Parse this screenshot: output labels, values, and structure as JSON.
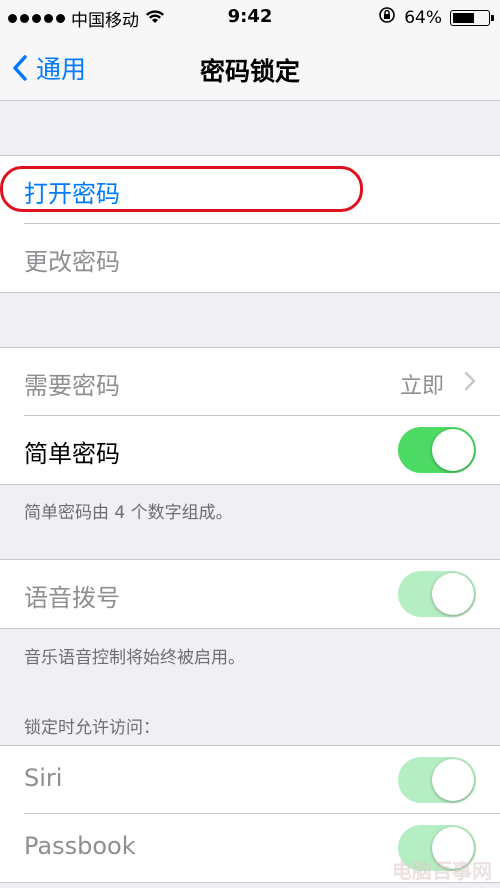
{
  "status_bar": {
    "carrier": "中国移动",
    "time": "9:42",
    "battery_text": "64%",
    "battery_level": 0.64
  },
  "nav": {
    "back_label": "通用",
    "title": "密码锁定"
  },
  "section1": {
    "turn_on": "打开密码",
    "change": "更改密码"
  },
  "section2": {
    "require_label": "需要密码",
    "require_value": "立即",
    "simple_label": "简单密码",
    "simple_on": true,
    "footer": "简单密码由 4 个数字组成。"
  },
  "section3": {
    "voice_label": "语音拨号",
    "voice_on": true,
    "footer": "音乐语音控制将始终被启用。"
  },
  "section4": {
    "header": "锁定时允许访问：",
    "siri_label": "Siri",
    "passbook_label": "Passbook"
  },
  "watermark": "电脑百事网",
  "colors": {
    "accent": "#007aff",
    "toggle_on": "#4cd964",
    "highlight": "#e0111e",
    "background": "#efeff4"
  }
}
